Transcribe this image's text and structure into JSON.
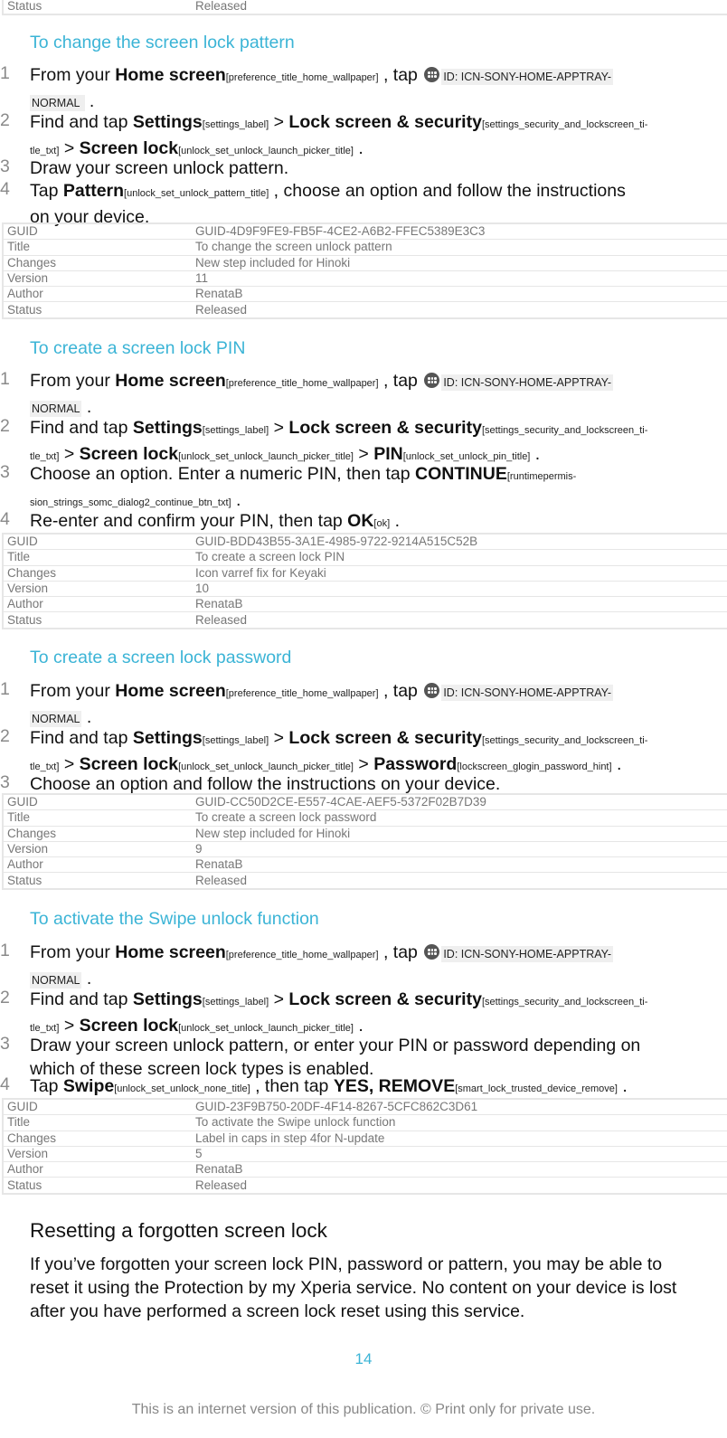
{
  "top_table": {
    "rows": [
      {
        "key": "Status",
        "value": "Released"
      }
    ]
  },
  "sections": [
    {
      "title": "To change the screen lock pattern",
      "steps": [
        {
          "num": "1",
          "parts": [
            {
              "t": "From your "
            },
            {
              "b": "Home screen"
            },
            {
              "r": "[preference_title_home_wallpaper]"
            },
            {
              "t": " , tap "
            },
            {
              "icon": "apptray-icon"
            },
            {
              "chip": "ID: ICN-SONY-HOME-APPTRAY-"
            },
            {
              "br": true
            },
            {
              "chip": "NORMAL "
            },
            {
              "t": " ."
            }
          ]
        },
        {
          "num": "2",
          "parts": [
            {
              "t": "Find and tap "
            },
            {
              "b": "Settings"
            },
            {
              "r": "[settings_label]"
            },
            {
              "t": " > "
            },
            {
              "b": "Lock screen & security"
            },
            {
              "r": "[settings_security_and_lockscreen_ti-"
            },
            {
              "br": true
            },
            {
              "r": "tle_txt]"
            },
            {
              "t": " > "
            },
            {
              "b": "Screen lock"
            },
            {
              "r": "[unlock_set_unlock_launch_picker_title]"
            },
            {
              "t": " ."
            }
          ]
        },
        {
          "num": "3",
          "parts": [
            {
              "t": "Draw your screen unlock pattern."
            }
          ]
        },
        {
          "num": "4",
          "parts": [
            {
              "t": "Tap "
            },
            {
              "b": "Pattern"
            },
            {
              "r": "[unlock_set_unlock_pattern_title]"
            },
            {
              "t": " , choose an option and follow the instructions"
            },
            {
              "br": true
            },
            {
              "t": "on your device."
            }
          ]
        }
      ],
      "meta": [
        {
          "key": "GUID",
          "value": "GUID-4D9F9FE9-FB5F-4CE2-A6B2-FFEC5389E3C3"
        },
        {
          "key": "Title",
          "value": "To change the screen unlock pattern"
        },
        {
          "key": "Changes",
          "value": "New step included for Hinoki"
        },
        {
          "key": "Version",
          "value": "11"
        },
        {
          "key": "Author",
          "value": "RenataB"
        },
        {
          "key": "Status",
          "value": "Released"
        }
      ]
    },
    {
      "title": "To create a screen lock PIN",
      "steps": [
        {
          "num": "1",
          "parts": [
            {
              "t": "From your "
            },
            {
              "b": "Home screen"
            },
            {
              "r": "[preference_title_home_wallpaper]"
            },
            {
              "t": " , tap "
            },
            {
              "icon": "apptray-icon"
            },
            {
              "chip": "ID: ICN-SONY-HOME-APPTRAY-"
            },
            {
              "br": true
            },
            {
              "chip": "NORMAL"
            },
            {
              "t": " ."
            }
          ]
        },
        {
          "num": "2",
          "parts": [
            {
              "t": "Find and tap "
            },
            {
              "b": "Settings"
            },
            {
              "r": "[settings_label]"
            },
            {
              "t": " > "
            },
            {
              "b": "Lock screen & security"
            },
            {
              "r": "[settings_security_and_lockscreen_ti-"
            },
            {
              "br": true
            },
            {
              "r": "tle_txt]"
            },
            {
              "t": " > "
            },
            {
              "b": "Screen lock"
            },
            {
              "r": "[unlock_set_unlock_launch_picker_title]"
            },
            {
              "t": " > "
            },
            {
              "b": "PIN"
            },
            {
              "r": "[unlock_set_unlock_pin_title]"
            },
            {
              "t": " ."
            }
          ]
        },
        {
          "num": "3",
          "parts": [
            {
              "t": "Choose an option. Enter a numeric PIN, then tap "
            },
            {
              "b": "CONTINUE"
            },
            {
              "r": "[runtimepermis-"
            },
            {
              "br": true
            },
            {
              "r": "sion_strings_somc_dialog2_continue_btn_txt]"
            },
            {
              "t": " ."
            }
          ]
        },
        {
          "num": "4",
          "parts": [
            {
              "t": "Re-enter and confirm your PIN, then tap "
            },
            {
              "b": "OK"
            },
            {
              "r": "[ok]"
            },
            {
              "t": " ."
            }
          ]
        }
      ],
      "meta": [
        {
          "key": "GUID",
          "value": "GUID-BDD43B55-3A1E-4985-9722-9214A515C52B"
        },
        {
          "key": "Title",
          "value": "To create a screen lock PIN"
        },
        {
          "key": "Changes",
          "value": "Icon varref fix for Keyaki"
        },
        {
          "key": "Version",
          "value": "10"
        },
        {
          "key": "Author",
          "value": "RenataB"
        },
        {
          "key": "Status",
          "value": "Released"
        }
      ]
    },
    {
      "title": "To create a screen lock password",
      "steps": [
        {
          "num": "1",
          "parts": [
            {
              "t": "From your "
            },
            {
              "b": "Home screen"
            },
            {
              "r": "[preference_title_home_wallpaper]"
            },
            {
              "t": " , tap "
            },
            {
              "icon": "apptray-icon"
            },
            {
              "chip": "ID: ICN-SONY-HOME-APPTRAY-"
            },
            {
              "br": true
            },
            {
              "chip": "NORMAL"
            },
            {
              "t": " ."
            }
          ]
        },
        {
          "num": "2",
          "parts": [
            {
              "t": "Find and tap "
            },
            {
              "b": "Settings"
            },
            {
              "r": "[settings_label]"
            },
            {
              "t": " > "
            },
            {
              "b": "Lock screen & security"
            },
            {
              "r": "[settings_security_and_lockscreen_ti-"
            },
            {
              "br": true
            },
            {
              "r": "tle_txt]"
            },
            {
              "t": " > "
            },
            {
              "b": "Screen lock"
            },
            {
              "r": "[unlock_set_unlock_launch_picker_title]"
            },
            {
              "t": " > "
            },
            {
              "b": "Password"
            },
            {
              "r": "[lockscreen_glogin_password_hint]"
            },
            {
              "t": " ."
            }
          ]
        },
        {
          "num": "3",
          "parts": [
            {
              "t": "Choose an option and follow the instructions on your device."
            }
          ]
        }
      ],
      "meta": [
        {
          "key": "GUID",
          "value": "GUID-CC50D2CE-E557-4CAE-AEF5-5372F02B7D39"
        },
        {
          "key": "Title",
          "value": "To create a screen lock password"
        },
        {
          "key": "Changes",
          "value": "New step included for Hinoki"
        },
        {
          "key": "Version",
          "value": "9"
        },
        {
          "key": "Author",
          "value": "RenataB"
        },
        {
          "key": "Status",
          "value": "Released"
        }
      ]
    },
    {
      "title": "To activate the Swipe unlock function",
      "steps": [
        {
          "num": "1",
          "parts": [
            {
              "t": "From your "
            },
            {
              "b": "Home screen"
            },
            {
              "r": "[preference_title_home_wallpaper]"
            },
            {
              "t": " , tap "
            },
            {
              "icon": "apptray-icon"
            },
            {
              "chip": "ID: ICN-SONY-HOME-APPTRAY-"
            },
            {
              "br": true
            },
            {
              "chip": "NORMAL"
            },
            {
              "t": " ."
            }
          ]
        },
        {
          "num": "2",
          "parts": [
            {
              "t": "Find and tap "
            },
            {
              "b": "Settings"
            },
            {
              "r": "[settings_label]"
            },
            {
              "t": " > "
            },
            {
              "b": "Lock screen & security"
            },
            {
              "r": "[settings_security_and_lockscreen_ti-"
            },
            {
              "br": true
            },
            {
              "r": "tle_txt]"
            },
            {
              "t": " > "
            },
            {
              "b": "Screen lock"
            },
            {
              "r": "[unlock_set_unlock_launch_picker_title]"
            },
            {
              "t": " ."
            }
          ]
        },
        {
          "num": "3",
          "parts": [
            {
              "t": "Draw your screen unlock pattern, or enter your PIN or password depending on"
            },
            {
              "br": true
            },
            {
              "t": "which of these screen lock types is enabled."
            }
          ]
        },
        {
          "num": "4",
          "parts": [
            {
              "t": "Tap "
            },
            {
              "b": "Swipe"
            },
            {
              "r": "[unlock_set_unlock_none_title]"
            },
            {
              "t": " , then tap "
            },
            {
              "b": "YES, REMOVE"
            },
            {
              "r": "[smart_lock_trusted_device_remove]"
            },
            {
              "t": " ."
            }
          ]
        }
      ],
      "meta": [
        {
          "key": "GUID",
          "value": "GUID-23F9B750-20DF-4F14-8267-5CFC862C3D61"
        },
        {
          "key": "Title",
          "value": "To activate the Swipe unlock function"
        },
        {
          "key": "Changes",
          "value": "Label in caps in step 4for N-update"
        },
        {
          "key": "Version",
          "value": "5"
        },
        {
          "key": "Author",
          "value": "RenataB"
        },
        {
          "key": "Status",
          "value": "Released"
        }
      ]
    }
  ],
  "reset": {
    "heading": "Resetting a forgotten screen lock",
    "body_lines": [
      "If you’ve forgotten your screen lock PIN, password or pattern, you may be able to",
      "reset it using the Protection by my Xperia service. No content on your device is lost",
      "after you have performed a screen lock reset using this service."
    ]
  },
  "page_number": "14",
  "footer": "This is an internet version of this publication. © Print only for private use.",
  "colors": {
    "accent": "#3bb4d6",
    "table_text": "#777777",
    "table_border": "#e6e6e6"
  }
}
